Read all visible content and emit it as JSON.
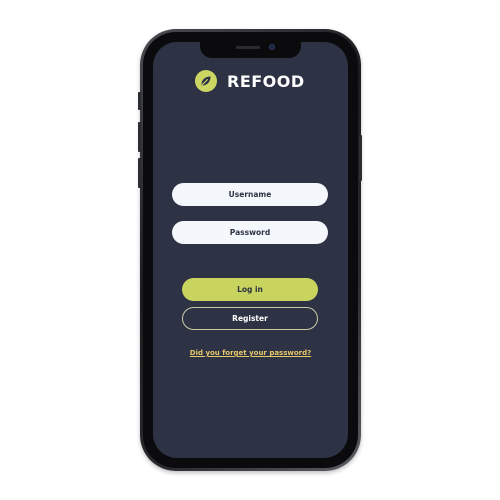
{
  "app": {
    "name": "REFOOD",
    "brand_color": "#cdd563",
    "background_color": "#2d3244",
    "logo_icon": "leaf-icon"
  },
  "form": {
    "username_placeholder": "Username",
    "password_placeholder": "Password",
    "login_label": "Log in",
    "register_label": "Register",
    "forgot_password_label": "Did you forget your password?"
  }
}
